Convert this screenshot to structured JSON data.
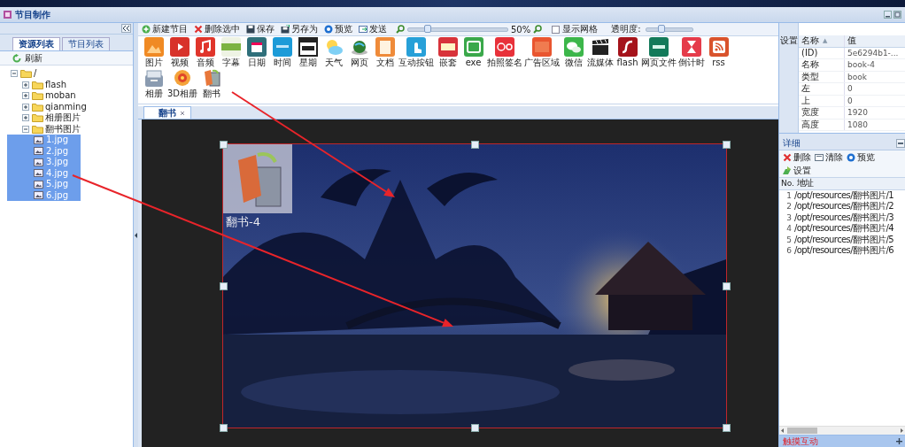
{
  "window": {
    "title": "节目制作"
  },
  "left_panel": {
    "tabs": [
      {
        "label": "资源列表",
        "selected": true
      },
      {
        "label": "节目列表",
        "selected": false
      }
    ],
    "refresh": "刷新",
    "tree": [
      {
        "label": "/",
        "expanded": true,
        "children": [
          {
            "label": "flash",
            "expanded": false
          },
          {
            "label": "moban",
            "expanded": false
          },
          {
            "label": "qianming",
            "expanded": false
          },
          {
            "label": "相册图片",
            "expanded": false
          },
          {
            "label": "翻书图片",
            "expanded": true,
            "children": [
              {
                "label": "1.jpg",
                "selected": true
              },
              {
                "label": "2.jpg",
                "selected": true
              },
              {
                "label": "3.jpg",
                "selected": true
              },
              {
                "label": "4.jpg",
                "selected": true
              },
              {
                "label": "5.jpg",
                "selected": true
              },
              {
                "label": "6.jpg",
                "selected": true
              }
            ]
          }
        ]
      }
    ]
  },
  "toolbar": {
    "buttons": [
      {
        "label": "新建节目"
      },
      {
        "label": "删除选中"
      },
      {
        "label": "保存"
      },
      {
        "label": "另存为"
      },
      {
        "label": "预览"
      },
      {
        "label": "发送"
      }
    ],
    "zoom": {
      "level": 0.17,
      "reading": "50%"
    },
    "grid_toggle": {
      "label": "显示网格",
      "checked": false
    },
    "opacity": {
      "label": "透明度:",
      "level": 0.3
    }
  },
  "components": [
    {
      "label": "图片"
    },
    {
      "label": "视频"
    },
    {
      "label": "音频"
    },
    {
      "label": "字幕"
    },
    {
      "label": "日期"
    },
    {
      "label": "时间"
    },
    {
      "label": "星期"
    },
    {
      "label": "天气"
    },
    {
      "label": "网页"
    },
    {
      "label": "文档"
    },
    {
      "label": "互动按钮"
    },
    {
      "label": "嵌套"
    },
    {
      "label": "exe"
    },
    {
      "label": "拍照签名"
    },
    {
      "label": "广告区域"
    },
    {
      "label": "微信"
    },
    {
      "label": "流媒体"
    },
    {
      "label": "flash"
    },
    {
      "label": "网页文件"
    },
    {
      "label": "倒计时"
    },
    {
      "label": "rss"
    },
    {
      "label": "相册"
    },
    {
      "label": "3D相册"
    },
    {
      "label": "翻书"
    }
  ],
  "editor_tabs": [
    {
      "label": "翻书",
      "selected": true
    }
  ],
  "canvas": {
    "element": {
      "kind": "picture",
      "label": "翻书-4",
      "selected": true
    }
  },
  "settings_tab": "设置",
  "properties": {
    "columns": [
      {
        "label": "名称",
        "sort_mark": "▲"
      },
      {
        "label": "值"
      }
    ],
    "rows": [
      [
        "(ID)",
        "5e6294b1-..."
      ],
      [
        "名称",
        "book-4"
      ],
      [
        "类型",
        "book"
      ],
      [
        "左",
        "0"
      ],
      [
        "上",
        "0"
      ],
      [
        "宽度",
        "1920"
      ],
      [
        "高度",
        "1080"
      ]
    ]
  },
  "details": {
    "title": "详细",
    "actions": [
      {
        "label": "删除"
      },
      {
        "label": "清除"
      },
      {
        "label": "预览"
      },
      {
        "label": "设置"
      }
    ],
    "columns": [
      "No.",
      "地址"
    ],
    "rows": [
      [
        "1",
        "/opt/resources/翻书图片/1"
      ],
      [
        "2",
        "/opt/resources/翻书图片/2"
      ],
      [
        "3",
        "/opt/resources/翻书图片/3"
      ],
      [
        "4",
        "/opt/resources/翻书图片/4"
      ],
      [
        "5",
        "/opt/resources/翻书图片/5"
      ],
      [
        "6",
        "/opt/resources/翻书图片/6"
      ]
    ]
  },
  "bottom_panel": {
    "title": "触摸互动"
  },
  "annotations": [
    {
      "kind": "arrow"
    },
    {
      "kind": "arrow"
    }
  ]
}
